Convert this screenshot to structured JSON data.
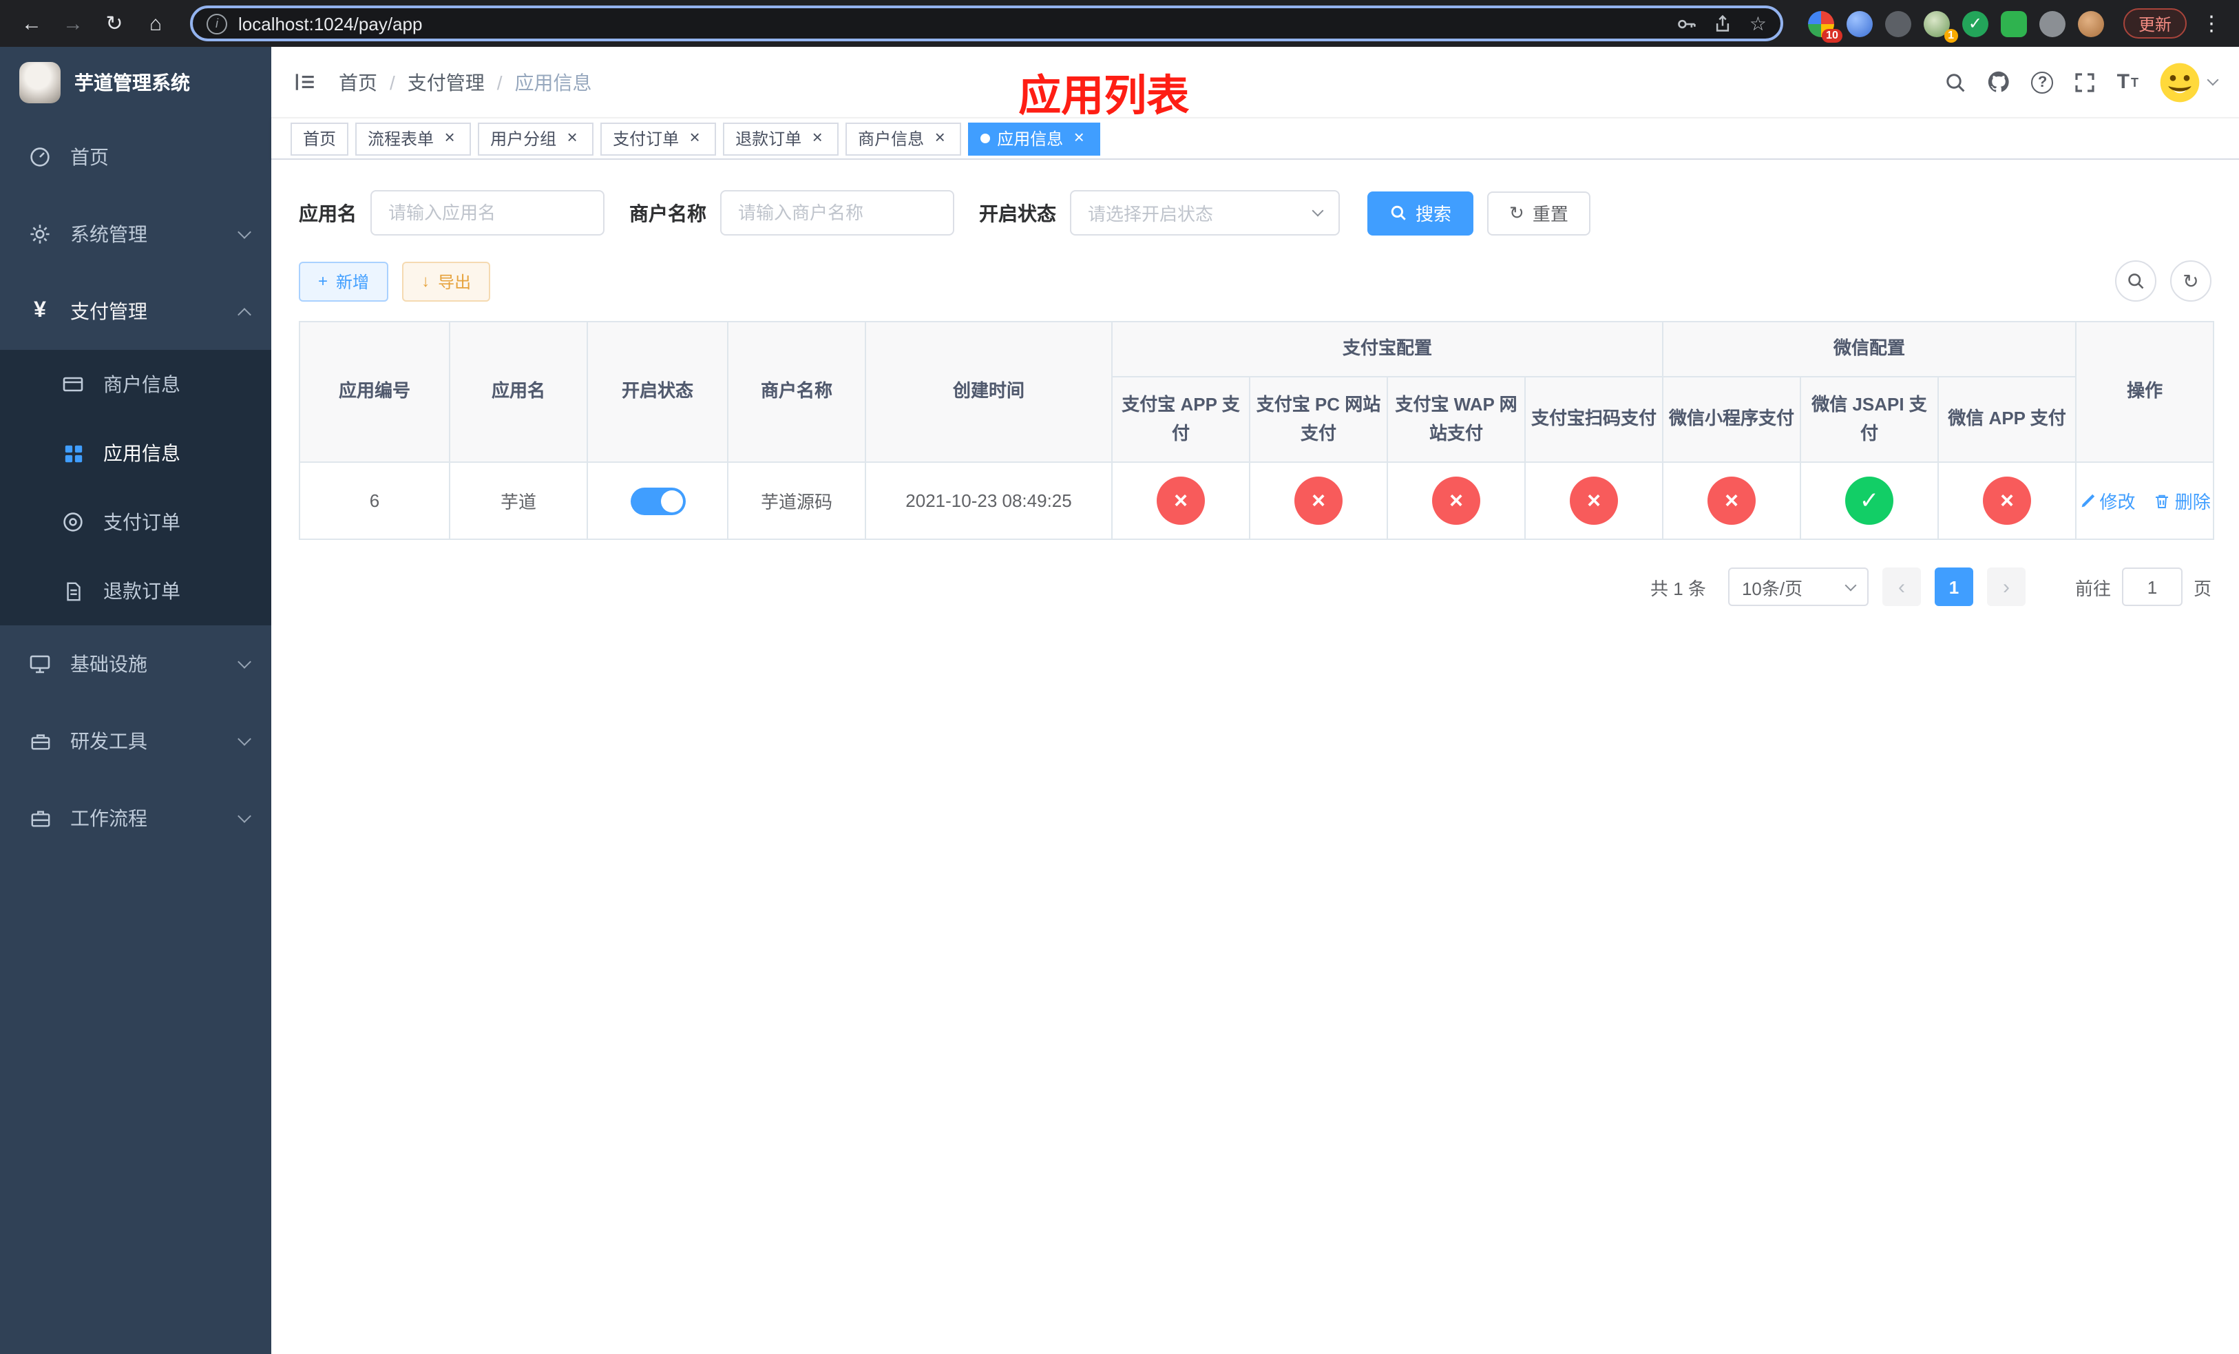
{
  "colors": {
    "accent": "#409eff",
    "danger": "#f85b5b",
    "success": "#12ce66",
    "warning": "#e6a23c",
    "sidebar_bg": "#304156",
    "submenu_bg": "#1f2d3d",
    "annotation": "#fe1e14"
  },
  "browser": {
    "back_icon": "←",
    "forward_icon": "→",
    "refresh_icon": "↻",
    "home_icon": "⌂",
    "info_icon": "i",
    "url": "localhost:1024/pay/app",
    "star_icon": "☆",
    "ext_badge_1": "10",
    "ext_badge_2": "1",
    "update_label": "更新",
    "menu_icon": "⋮"
  },
  "sidebar": {
    "title": "芋道管理系统",
    "menu": [
      {
        "label": "首页"
      },
      {
        "label": "系统管理"
      },
      {
        "label": "支付管理"
      },
      {
        "label": "基础设施"
      },
      {
        "label": "研发工具"
      },
      {
        "label": "工作流程"
      }
    ],
    "submenu": [
      {
        "label": "商户信息"
      },
      {
        "label": "应用信息"
      },
      {
        "label": "支付订单"
      },
      {
        "label": "退款订单"
      }
    ]
  },
  "header": {
    "breadcrumb": [
      "首页",
      "支付管理",
      "应用信息"
    ],
    "annotation": "应用列表",
    "help_icon": "?",
    "font_icon_large": "T",
    "font_icon_small": "T"
  },
  "tabs": {
    "close_icon": "×",
    "items": [
      {
        "label": "首页"
      },
      {
        "label": "流程表单"
      },
      {
        "label": "用户分组"
      },
      {
        "label": "支付订单"
      },
      {
        "label": "退款订单"
      },
      {
        "label": "商户信息"
      },
      {
        "label": "应用信息"
      }
    ]
  },
  "filters": {
    "app_name": {
      "label": "应用名",
      "placeholder": "请输入应用名"
    },
    "merchant_name": {
      "label": "商户名称",
      "placeholder": "请输入商户名称"
    },
    "status": {
      "label": "开启状态",
      "placeholder": "请选择开启状态"
    },
    "search": "搜索",
    "reset": "重置",
    "reset_icon": "↻"
  },
  "toolbar": {
    "add": "新增",
    "add_icon": "+",
    "export": "导出",
    "export_icon": "↓",
    "refresh_icon": "↻"
  },
  "table": {
    "groups": {
      "alipay": "支付宝配置",
      "wechat": "微信配置"
    },
    "columns": {
      "id": "应用编号",
      "name": "应用名",
      "status": "开启状态",
      "merchant": "商户名称",
      "created": "创建时间",
      "alipay_app": "支付宝 APP 支付",
      "alipay_pc": "支付宝 PC 网站支付",
      "alipay_wap": "支付宝 WAP 网站支付",
      "alipay_qr": "支付宝扫码支付",
      "wx_lite": "微信小程序支付",
      "wx_jsapi": "微信 JSAPI 支付",
      "wx_app": "微信 APP 支付",
      "ops": "操作"
    },
    "status_yes_icon": "✓",
    "status_no_icon": "×",
    "rows": [
      {
        "id": "6",
        "name": "芋道",
        "enabled": true,
        "merchant": "芋道源码",
        "created": "2021-10-23 08:49:25",
        "configs": [
          false,
          false,
          false,
          false,
          false,
          true,
          false
        ],
        "edit": "修改",
        "delete": "删除"
      }
    ]
  },
  "pagination": {
    "total": "共 1 条",
    "page_size": "10条/页",
    "prev_icon": "‹",
    "next_icon": "›",
    "page": "1",
    "goto_label": "前往",
    "goto_value": "1",
    "goto_unit": "页"
  }
}
